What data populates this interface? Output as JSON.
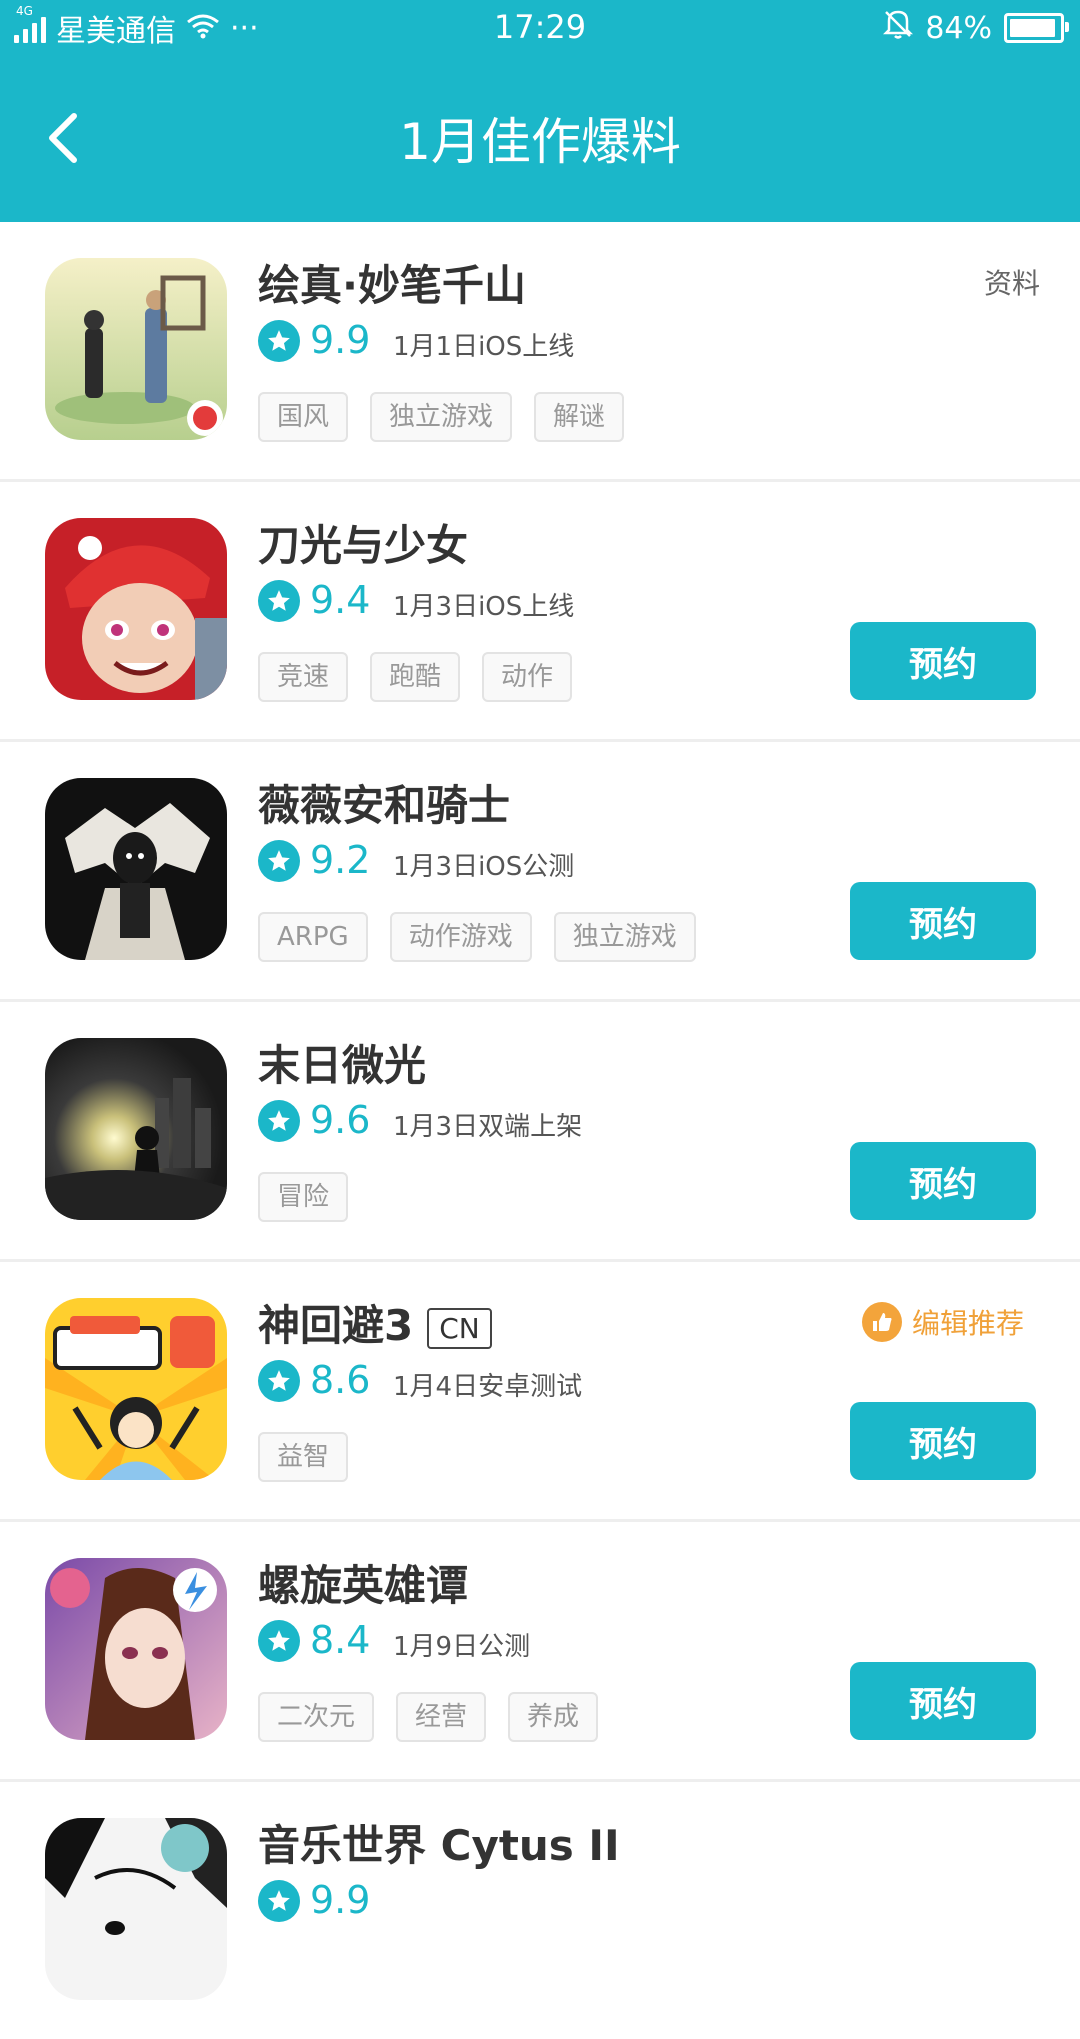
{
  "status_bar": {
    "network": "4G",
    "carrier": "星美通信",
    "more": "···",
    "time": "17:29",
    "battery": "84%"
  },
  "header": {
    "title": "1月佳作爆料"
  },
  "colors": {
    "accent": "#1bb7c9",
    "recommend": "#f3a43b"
  },
  "games": [
    {
      "name": "绘真·妙笔千山",
      "score": "9.9",
      "date": "1月1日iOS上线",
      "tags": [
        "国风",
        "独立游戏",
        "解谜"
      ],
      "info_label": "资料",
      "icon": "game-icon-huizhen"
    },
    {
      "name": "刀光与少女",
      "score": "9.4",
      "date": "1月3日iOS上线",
      "tags": [
        "竞速",
        "跑酷",
        "动作"
      ],
      "button": "预约",
      "icon": "game-icon-daoguang"
    },
    {
      "name": "薇薇安和骑士",
      "score": "9.2",
      "date": "1月3日iOS公测",
      "tags": [
        "ARPG",
        "动作游戏",
        "独立游戏"
      ],
      "button": "预约",
      "icon": "game-icon-vivian"
    },
    {
      "name": "末日微光",
      "score": "9.6",
      "date": "1月3日双端上架",
      "tags": [
        "冒险"
      ],
      "button": "预约",
      "icon": "game-icon-morigiguang"
    },
    {
      "name": "神回避3",
      "badge": "CN",
      "score": "8.6",
      "date": "1月4日安卓测试",
      "tags": [
        "益智"
      ],
      "button": "预约",
      "recommend": "编辑推荐",
      "icon": "game-icon-shenhuibi"
    },
    {
      "name": "螺旋英雄谭",
      "score": "8.4",
      "date": "1月9日公测",
      "tags": [
        "二次元",
        "经营",
        "养成"
      ],
      "button": "预约",
      "icon": "game-icon-luoxuan"
    },
    {
      "name": "音乐世界 Cytus II",
      "score": "9.9",
      "icon": "game-icon-cytus"
    }
  ]
}
